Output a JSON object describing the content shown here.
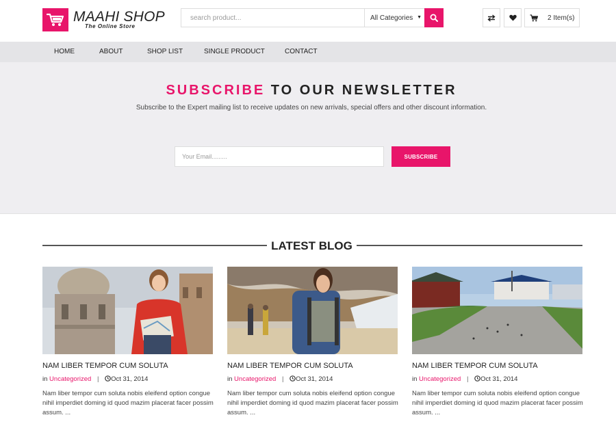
{
  "header": {
    "logo_title": "MAAHI SHOP",
    "logo_subtitle": "The Online Store",
    "search_placeholder": "search product...",
    "category_selected": "All Categories",
    "cart_label": "2 Item(s)"
  },
  "nav": {
    "items": [
      "HOME",
      "ABOUT",
      "SHOP LIST",
      "SINGLE PRODUCT",
      "CONTACT"
    ]
  },
  "newsletter": {
    "title_accent": "SUBSCRIBE",
    "title_rest": "TO OUR NEWSLETTER",
    "description": "Subscribe to the Expert mailing list to receive updates on new arrivals, special offers and other discount information.",
    "email_placeholder": "Your Email.........",
    "button_label": "SUBSCRIBE"
  },
  "blog": {
    "heading": "LATEST BLOG",
    "posts": [
      {
        "title": "NAM LIBER TEMPOR CUM SOLUTA",
        "in_label": "in",
        "category": "Uncategorized",
        "date": "Oct 31, 2014",
        "excerpt": "Nam liber tempor cum soluta nobis eleifend option congue nihil imperdiet doming id quod mazim placerat facer possim assum. ..."
      },
      {
        "title": "NAM LIBER TEMPOR CUM SOLUTA",
        "in_label": "in",
        "category": "Uncategorized",
        "date": "Oct 31, 2014",
        "excerpt": "Nam liber tempor cum soluta nobis eleifend option congue nihil imperdiet doming id quod mazim placerat facer possim assum. ..."
      },
      {
        "title": "NAM LIBER TEMPOR CUM SOLUTA",
        "in_label": "in",
        "category": "Uncategorized",
        "date": "Oct 31, 2014",
        "excerpt": "Nam liber tempor cum soluta nobis eleifend option congue nihil imperdiet doming id quod mazim placerat facer possim assum. ..."
      }
    ]
  },
  "icons": {
    "logo": "cart-icon",
    "search": "search-icon",
    "compare": "exchange-icon",
    "wishlist": "heart-icon",
    "cart": "cart-icon",
    "date": "clock-icon"
  },
  "colors": {
    "accent": "#e8156a",
    "nav_bg": "#e4e4e7",
    "newsletter_bg": "#efeef1"
  }
}
